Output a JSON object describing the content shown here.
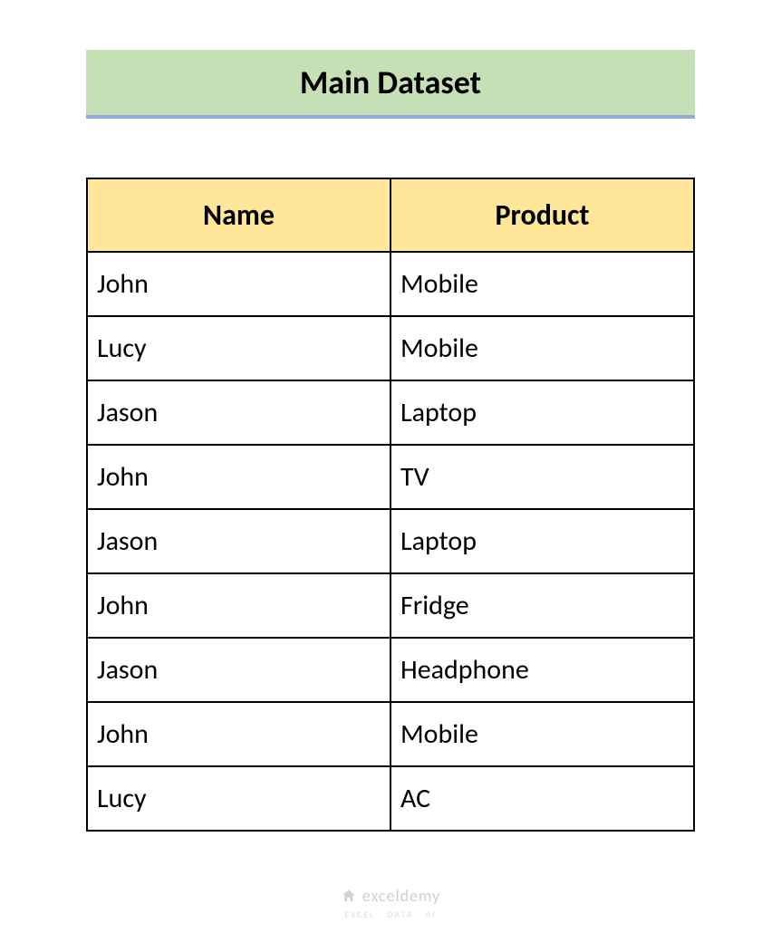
{
  "title": "Main Dataset",
  "table": {
    "headers": {
      "name": "Name",
      "product": "Product"
    },
    "rows": [
      {
        "name": "John",
        "product": "Mobile"
      },
      {
        "name": "Lucy",
        "product": "Mobile"
      },
      {
        "name": "Jason",
        "product": "Laptop"
      },
      {
        "name": "John",
        "product": "TV"
      },
      {
        "name": "Jason",
        "product": "Laptop"
      },
      {
        "name": "John",
        "product": "Fridge"
      },
      {
        "name": "Jason",
        "product": "Headphone"
      },
      {
        "name": "John",
        "product": "Mobile"
      },
      {
        "name": "Lucy",
        "product": "AC"
      }
    ]
  },
  "watermark": {
    "main": "exceldemy",
    "sub": "EXCEL · DATA · AI"
  }
}
